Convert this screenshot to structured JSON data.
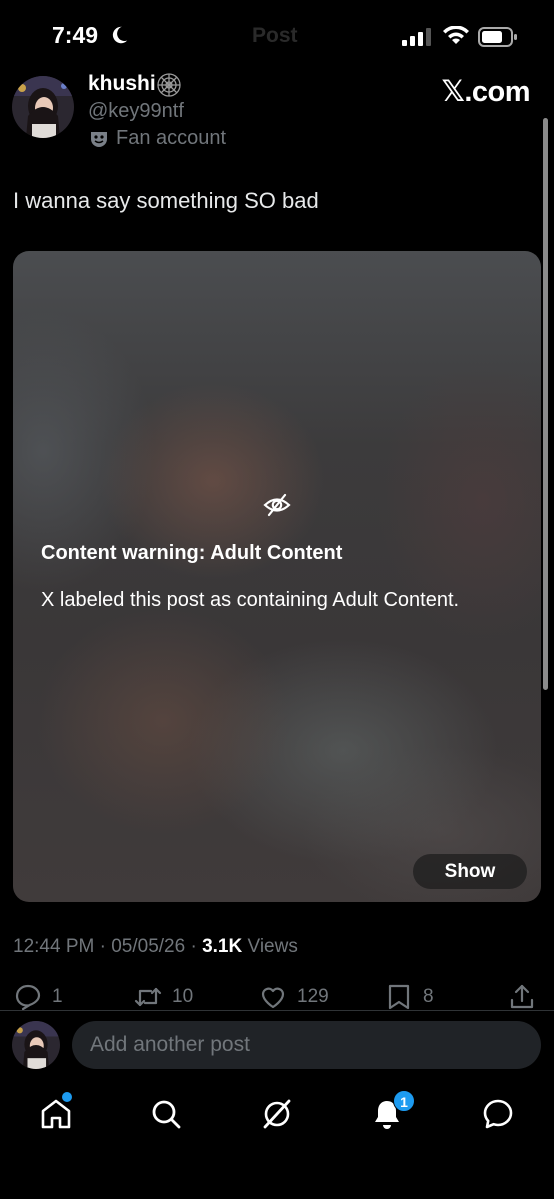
{
  "status_bar": {
    "time": "7:49",
    "page_title_ghost": "Post"
  },
  "author": {
    "display_name": "khushi",
    "handle": "@key99ntf",
    "label": "Fan account"
  },
  "brand": {
    "x_glyph": "𝕏",
    "domain": ".com"
  },
  "post": {
    "text": "I wanna say something SO bad",
    "content_warning_title": "Content warning: Adult Content",
    "content_warning_body": "X labeled this post as containing Adult Content.",
    "show_label": "Show",
    "time": "12:44 PM",
    "date": "05/05/26",
    "views_count": "3.1K",
    "views_label": "Views",
    "separator": "·"
  },
  "actions": {
    "replies": "1",
    "reposts": "10",
    "likes": "129",
    "bookmarks": "8"
  },
  "composer": {
    "placeholder": "Add another post"
  },
  "nav": {
    "notifications_badge": "1",
    "accent_color": "#1d9bf0"
  }
}
